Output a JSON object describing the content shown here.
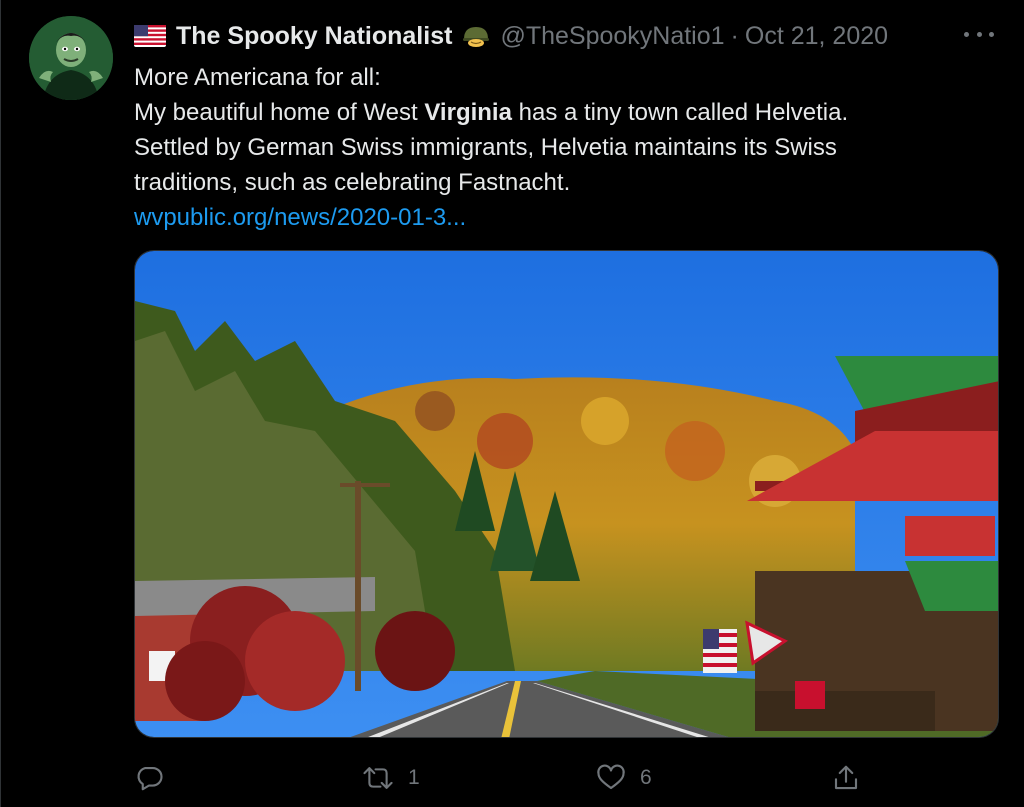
{
  "tweet": {
    "author": {
      "display_name": "The Spooky Nationalist",
      "handle": "@TheSpookyNatio1",
      "flag_icon": "us-flag-icon",
      "badge_icon": "army-helmet-icon"
    },
    "separator": "·",
    "date": "Oct 21, 2020",
    "text": {
      "line1": "More Americana for all:",
      "line2_pre": "My beautiful home of West ",
      "line2_bold": "Virginia",
      "line2_post": " has a tiny town called Helvetia.",
      "line3": "Settled by German Swiss immigrants, Helvetia maintains its Swiss",
      "line4": "traditions, such as celebrating Fastnacht.",
      "link": "wvpublic.org/news/2020-01-3..."
    },
    "media": {
      "description_icon": "photo"
    },
    "actions": {
      "reply_count": "",
      "retweet_count": "1",
      "like_count": "6"
    },
    "colors": {
      "background": "#000000",
      "text": "#e7e9ea",
      "secondary": "#71767b",
      "link": "#1d9bf0"
    }
  }
}
